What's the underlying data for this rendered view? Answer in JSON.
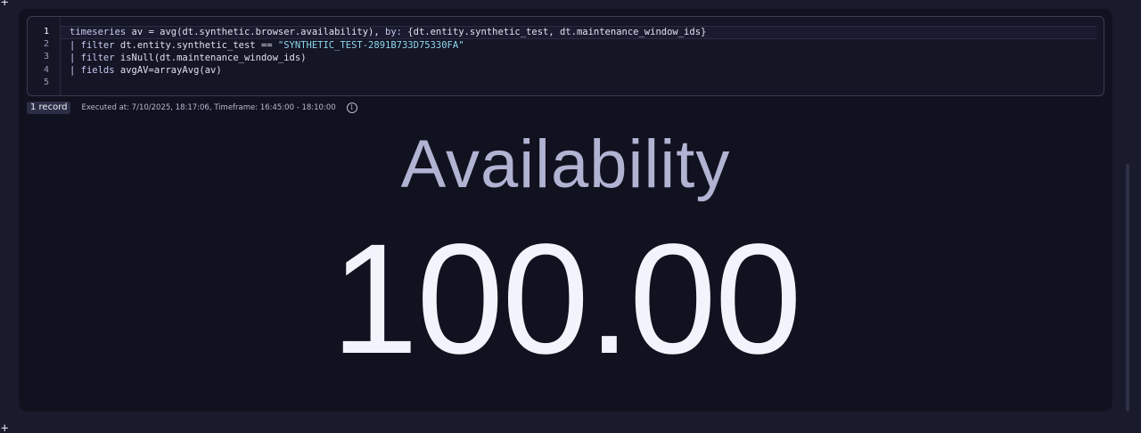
{
  "editor": {
    "line_numbers": [
      "1",
      "2",
      "3",
      "4",
      "5"
    ],
    "lines": [
      {
        "parts": [
          {
            "t": "timeseries",
            "c": "kw"
          },
          {
            "t": " av = avg(dt.synthetic.browser.availability), ",
            "c": ""
          },
          {
            "t": "by:",
            "c": "kw"
          },
          {
            "t": " {dt.entity.synthetic_test, dt.maintenance_window_ids}",
            "c": ""
          }
        ]
      },
      {
        "parts": [
          {
            "t": "| filter",
            "c": "kw"
          },
          {
            "t": " dt.entity.synthetic_test == ",
            "c": ""
          },
          {
            "t": "\"SYNTHETIC_TEST-2891B733D75330FA\"",
            "c": "str"
          }
        ]
      },
      {
        "parts": [
          {
            "t": "| filter",
            "c": "kw"
          },
          {
            "t": " isNull(dt.maintenance_window_ids)",
            "c": ""
          }
        ]
      },
      {
        "parts": [
          {
            "t": "| fields",
            "c": "kw"
          },
          {
            "t": " avgAV=arrayAvg(av)",
            "c": ""
          }
        ]
      },
      {
        "parts": []
      }
    ]
  },
  "status": {
    "records_badge": "1 record",
    "executed_text": "Executed at: 7/10/2025, 18:17:06, Timeframe: 16:45:00 - 18:10:00",
    "info_icon": "info-icon"
  },
  "single_value": {
    "label": "Availability",
    "value": "100.00"
  },
  "corner_marks": {
    "top": "+",
    "bottom": "+"
  }
}
